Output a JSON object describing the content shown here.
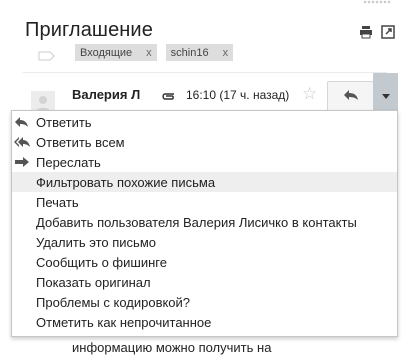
{
  "header": {
    "subject": "Приглашение",
    "labels": [
      {
        "name": "Входящие",
        "remove": "x"
      },
      {
        "name": "schin16",
        "remove": "x"
      }
    ]
  },
  "message": {
    "sender": "Валерия Л",
    "time": "16:10 (17 ч. назад)",
    "body_snippet": "информацию можно получить на"
  },
  "menu": {
    "items": [
      {
        "label": "Ответить",
        "icon": "reply-icon"
      },
      {
        "label": "Ответить всем",
        "icon": "reply-all-icon"
      },
      {
        "label": "Переслать",
        "icon": "forward-icon"
      },
      {
        "label": "Фильтровать похожие письма",
        "highlighted": true
      },
      {
        "label": "Печать"
      },
      {
        "label": "Добавить пользователя Валерия Лисичко в контакты"
      },
      {
        "label": "Удалить это письмо"
      },
      {
        "label": "Сообщить о фишинге"
      },
      {
        "label": "Показать оригинал"
      },
      {
        "label": "Проблемы с кодировкой?"
      },
      {
        "label": "Отметить как непрочитанное"
      }
    ]
  },
  "colors": {
    "menu_highlight": "#eeeeee",
    "more_button_active": "#c2c9cf",
    "label_chip": "#dddddd"
  }
}
